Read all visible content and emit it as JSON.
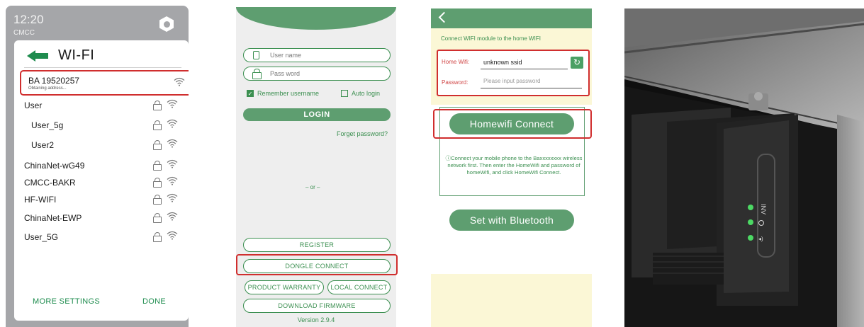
{
  "phone_wifi": {
    "status_time": "12:20",
    "carrier": "CMCC",
    "title": "WI-FI",
    "selected_network": {
      "name": "BA 19520257",
      "status": "Obtaining address..."
    },
    "networks": [
      {
        "name": "User"
      },
      {
        "name": "User_5g"
      },
      {
        "name": "User2"
      },
      {
        "name": "ChinaNet-wG49"
      },
      {
        "name": "CMCC-BAKR"
      },
      {
        "name": "HF-WIFI"
      },
      {
        "name": "ChinaNet-EWP"
      },
      {
        "name": "User_5G"
      }
    ],
    "more_settings_label": "MORE SETTINGS",
    "done_label": "DONE"
  },
  "login_screen": {
    "username_placeholder": "User name",
    "password_placeholder": "Pass word",
    "remember_label": "Remember username",
    "remember_checked": true,
    "auto_login_label": "Auto login",
    "auto_login_checked": false,
    "login_label": "LOGIN",
    "forgot_label": "Forget password?",
    "or_label": "– or –",
    "register_label": "REGISTER",
    "dongle_connect_label": "DONGLE CONNECT",
    "product_warranty_label": "PRODUCT WARRANTY",
    "local_connect_label": "LOCAL CONNECT",
    "download_firmware_label": "DOWNLOAD FIRMWARE",
    "version": "Version 2.9.4"
  },
  "wifi_connect": {
    "hint": "Connect WIFI module to the home WIFI",
    "home_wifi_label": "Home Wifi:",
    "home_wifi_value": "unknown ssid",
    "password_label": "Password:",
    "password_placeholder": "Please input password",
    "homewifi_connect_label": "Homewifi Connect",
    "info_icon": "info-icon",
    "info_text": "Connect your mobile phone to the Baxxxxxxxx wireless network first. Then enter the HomeWifi and password of homeWifi, and click HomeWifi Connect.",
    "bluetooth_label": "Set with Bluetooth"
  },
  "photo": {
    "indicator_labels": [
      "INV",
      "",
      ""
    ]
  },
  "colors": {
    "accent_green": "#5e9e70",
    "dark_green": "#1e8c4e",
    "highlight_red": "#d02e2e",
    "cream": "#fbf7d6",
    "led_green": "#4cd964"
  }
}
